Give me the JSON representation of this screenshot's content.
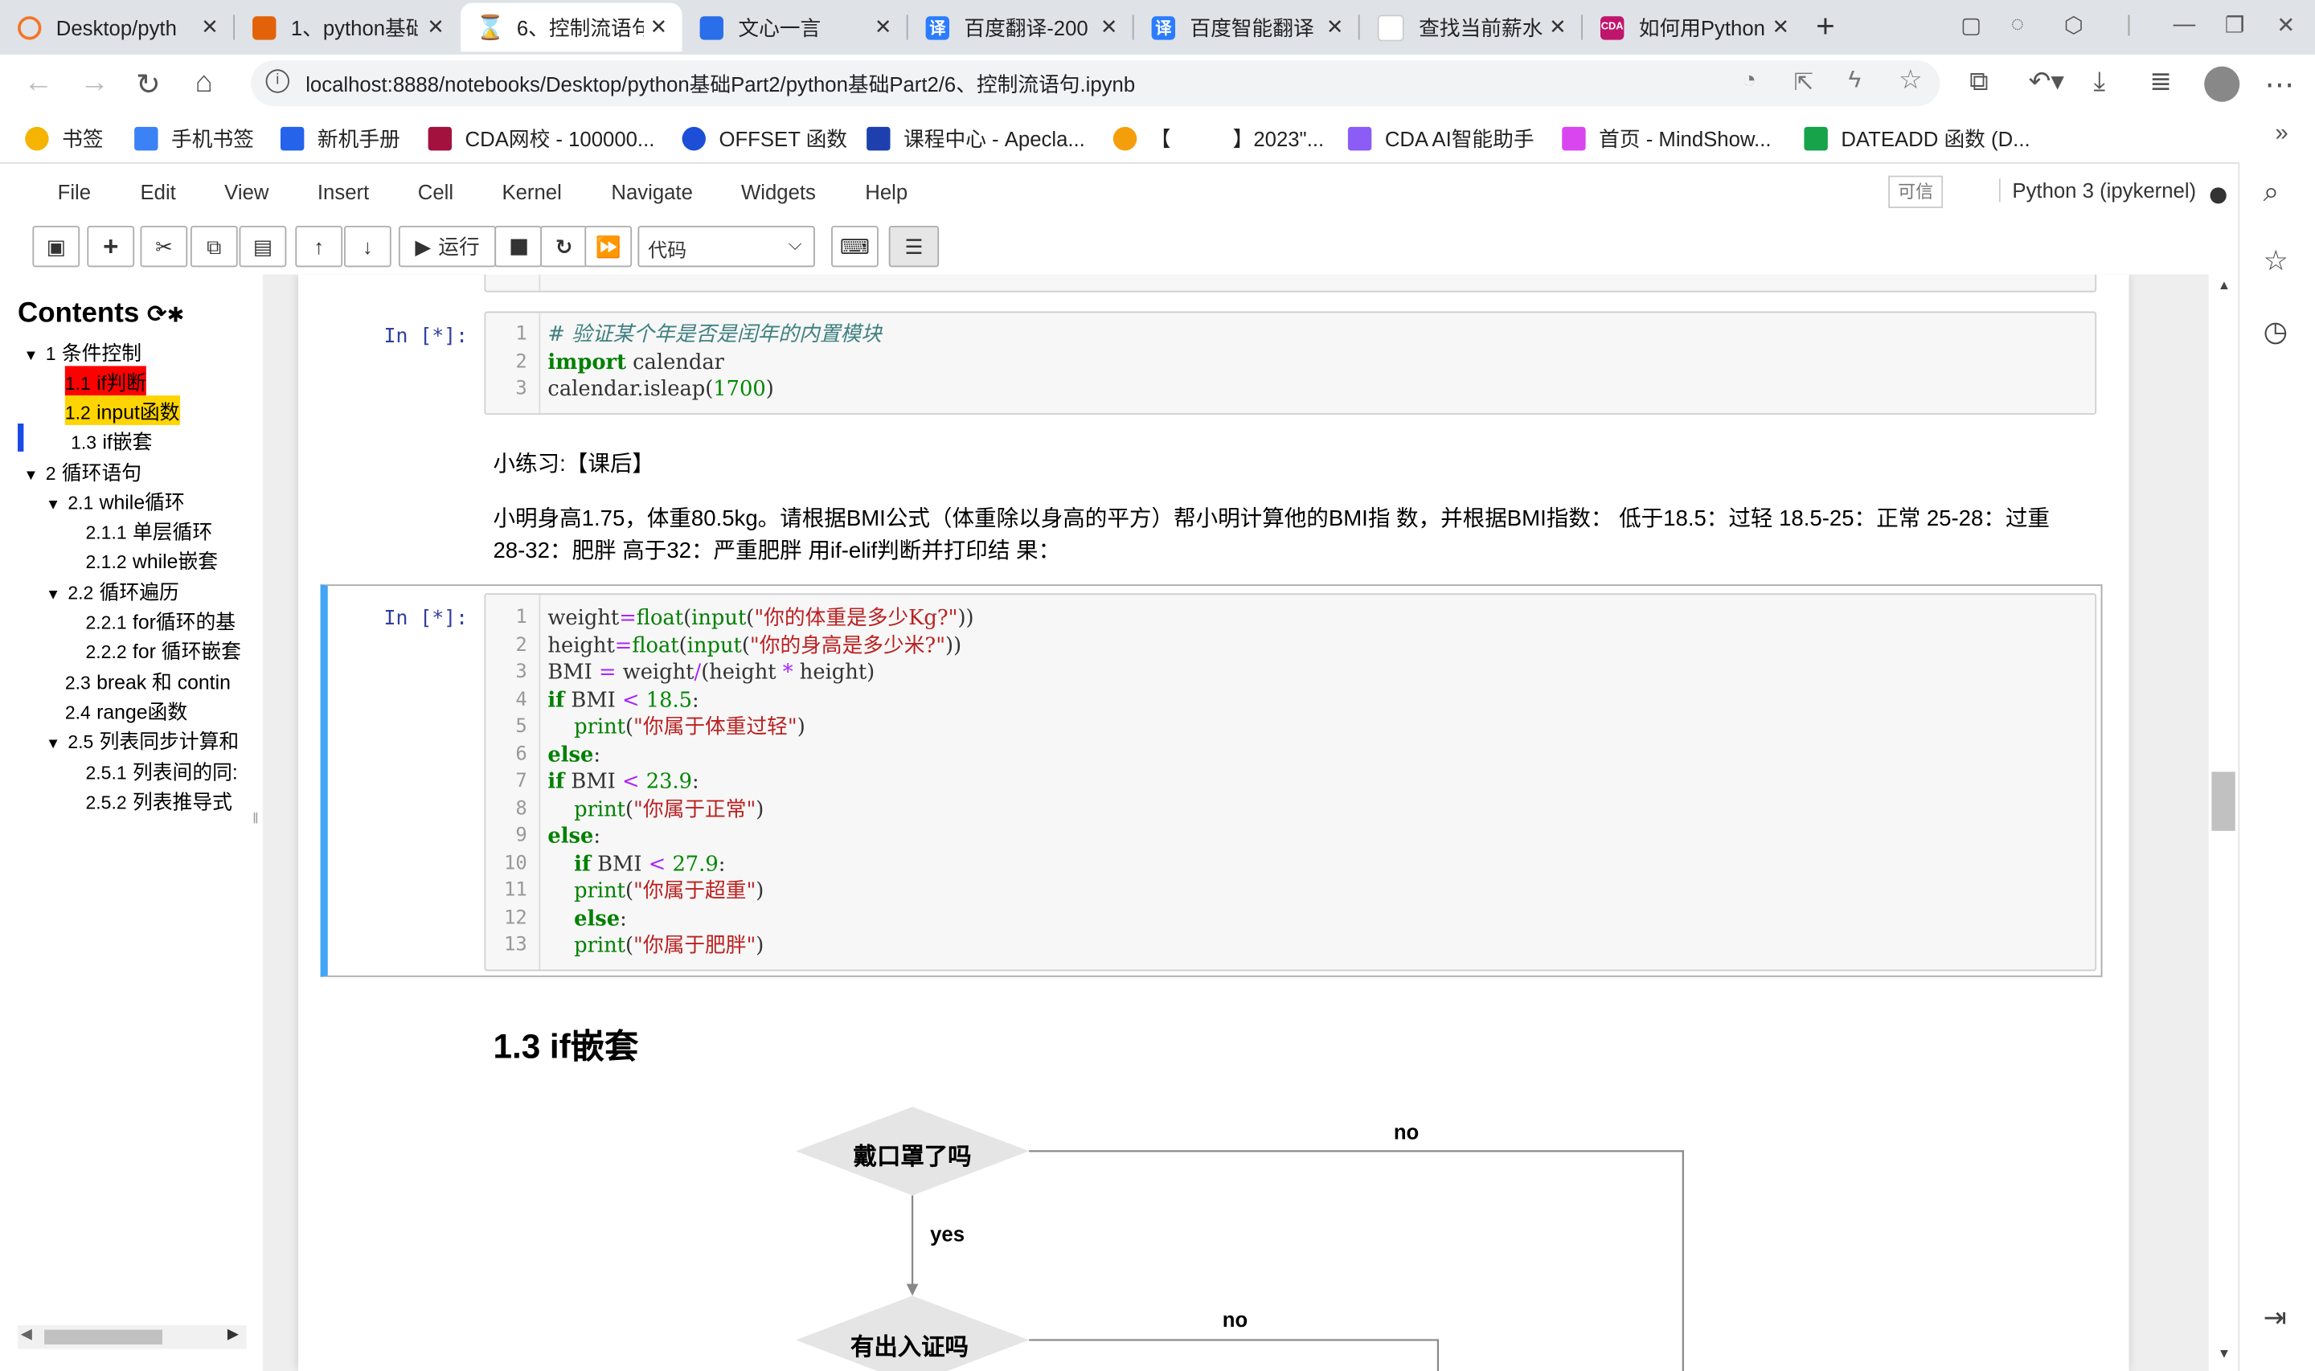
{
  "browser": {
    "tabs": [
      {
        "title": "Desktop/pyth",
        "icon": "jupyter-icon",
        "color": "#f37626"
      },
      {
        "title": "1、python基础",
        "icon": "book-icon",
        "color": "#e36209"
      },
      {
        "title": "6、控制流语句",
        "icon": "hourglass-icon",
        "color": "#f37626"
      },
      {
        "title": "文心一言",
        "icon": "cube-icon",
        "color": "#2b6ee9"
      },
      {
        "title": "百度翻译-200",
        "icon": "translate-icon",
        "color": "#2b7cff"
      },
      {
        "title": "百度智能翻译",
        "icon": "translate-icon",
        "color": "#2b7cff"
      },
      {
        "title": "查找当前薪水",
        "icon": "site-icon",
        "color": "#d33"
      },
      {
        "title": "如何用Python",
        "icon": "cda-icon",
        "color": "#c0156c"
      }
    ],
    "new_tab": "+",
    "url": "localhost:8888/notebooks/Desktop/python基础Part2/python基础Part2/6、控制流语句.ipynb",
    "bookmarks": [
      {
        "label": "书签",
        "color": "#f5b400"
      },
      {
        "label": "手机书签",
        "color": "#3b82f6"
      },
      {
        "label": "新机手册",
        "color": "#2563eb"
      },
      {
        "label": "CDA网校 - 100000...",
        "color": "#a3123e"
      },
      {
        "label": "OFFSET 函数",
        "color": "#1d4ed8"
      },
      {
        "label": "课程中心 - Apecla...",
        "color": "#1e40af"
      },
      {
        "label": "【　　　】2023\"...",
        "color": "#f59e0b"
      },
      {
        "label": "CDA AI智能助手",
        "color": "#8b5cf6"
      },
      {
        "label": "首页 - MindShow...",
        "color": "#d946ef"
      },
      {
        "label": "DATEADD 函数 (D...",
        "color": "#16a34a"
      }
    ]
  },
  "jupyter": {
    "menu": [
      "File",
      "Edit",
      "View",
      "Insert",
      "Cell",
      "Kernel",
      "Navigate",
      "Widgets",
      "Help"
    ],
    "trusted": "可信",
    "kernel": "Python 3 (ipykernel)",
    "run_label": "运行",
    "cell_type": "代码"
  },
  "toc": {
    "title": "Contents",
    "items": [
      {
        "num": "1",
        "label": "条件控制"
      },
      {
        "num": "1.1",
        "label": "if判断"
      },
      {
        "num": "1.2",
        "label": "input函数"
      },
      {
        "num": "1.3",
        "label": "if嵌套"
      },
      {
        "num": "2",
        "label": "循环语句"
      },
      {
        "num": "2.1",
        "label": "while循环"
      },
      {
        "num": "2.1.1",
        "label": "单层循环"
      },
      {
        "num": "2.1.2",
        "label": "while嵌套"
      },
      {
        "num": "2.2",
        "label": "循环遍历"
      },
      {
        "num": "2.2.1",
        "label": "for循环的基"
      },
      {
        "num": "2.2.2",
        "label": "for 循环嵌套"
      },
      {
        "num": "2.3",
        "label": "break 和 contin"
      },
      {
        "num": "2.4",
        "label": "range函数"
      },
      {
        "num": "2.5",
        "label": "列表同步计算和"
      },
      {
        "num": "2.5.1",
        "label": "列表间的同:"
      },
      {
        "num": "2.5.2",
        "label": "列表推导式"
      }
    ]
  },
  "cells": {
    "cell1_prompt": "In  [*]:",
    "cell1_lines": [
      "1",
      "2",
      "3"
    ],
    "cell2_prompt": "In  [*]:",
    "cell2_lines": [
      "1",
      "2",
      "3",
      "4",
      "5",
      "6",
      "7",
      "8",
      "9",
      "10",
      "11",
      "12",
      "13"
    ],
    "md_exercise": "小练习:【课后】",
    "md_problem_line1": "小明身高1.75，体重80.5kg。请根据BMI公式（体重除以身高的平方）帮小明计算他的BMI指 数，并根据BMI指数： 低于18.5：过轻 18.5-25：正常 25-28：过重",
    "md_problem_line2": "28-32：肥胖 高于32：严重肥胖 用if-elif判断并打印结 果：",
    "heading": "1.3  if嵌套"
  },
  "flowchart": {
    "node1": "戴口罩了吗",
    "node2": "有出入证吗",
    "yes": "yes",
    "no1": "no",
    "no2": "no"
  }
}
